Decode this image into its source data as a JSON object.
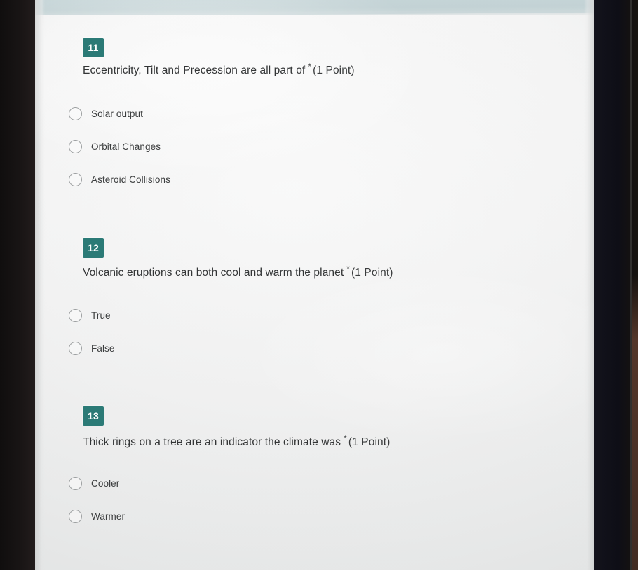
{
  "form": {
    "required_marker": "*",
    "points_label": "(1 Point)",
    "badge_color": "#2b7a76",
    "questions": [
      {
        "number": "11",
        "text": "Eccentricity, Tilt and Precession are all part of",
        "required": "*",
        "points": "(1 Point)",
        "options": [
          {
            "label": "Solar output",
            "selected": false
          },
          {
            "label": "Orbital Changes",
            "selected": false
          },
          {
            "label": "Asteroid Collisions",
            "selected": false
          }
        ]
      },
      {
        "number": "12",
        "text": "Volcanic eruptions can both cool and warm the planet",
        "required": "*",
        "points": "(1 Point)",
        "options": [
          {
            "label": "True",
            "selected": false
          },
          {
            "label": "False",
            "selected": false
          }
        ]
      },
      {
        "number": "13",
        "text": "Thick rings on a tree are an indicator the climate was",
        "required": "*",
        "points": "(1 Point)",
        "options": [
          {
            "label": "Cooler",
            "selected": false
          },
          {
            "label": "Warmer",
            "selected": false
          }
        ]
      }
    ]
  }
}
